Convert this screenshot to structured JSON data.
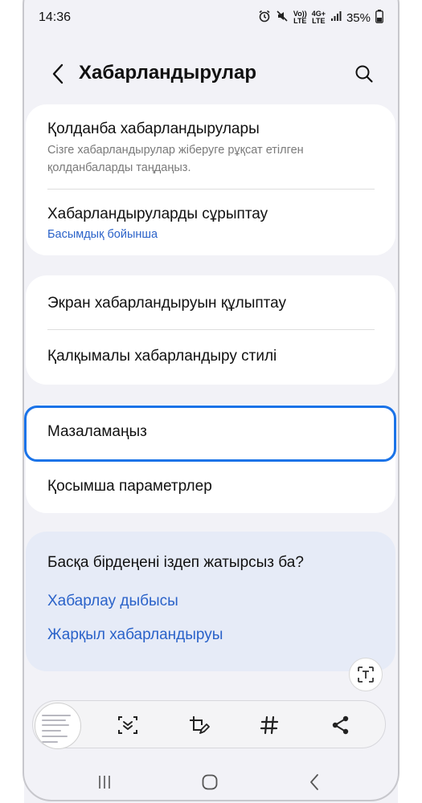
{
  "status_bar": {
    "time": "14:36",
    "volte_top": "Vo))",
    "volte_bottom": "LTE",
    "net_top": "4G+",
    "net_bottom": "LTE",
    "battery": "35%"
  },
  "header": {
    "title": "Хабарландырулар"
  },
  "card1": {
    "item1_title": "Қолданба хабарландырулары",
    "item1_subtitle": "Сізге хабарландырулар жіберуге рұқсат етілген қолданбаларды таңдаңыз.",
    "item2_title": "Хабарландыруларды сұрыптау",
    "item2_value": "Басымдық бойынша"
  },
  "card2": {
    "item1_title": "Экран хабарландыруын құлыптау",
    "item2_title": "Қалқымалы хабарландыру стилі"
  },
  "card3": {
    "item1_title": "Мазаламаңыз",
    "item2_title": "Қосымша параметрлер"
  },
  "suggestions": {
    "title": "Басқа бірдеңені іздеп жатырсыз ба?",
    "links": [
      "Хабарлау дыбысы",
      "Жарқыл хабарландыруы"
    ]
  },
  "colors": {
    "accent": "#2a62c9",
    "highlight": "#1a73e8",
    "background": "#f2f2f7"
  }
}
